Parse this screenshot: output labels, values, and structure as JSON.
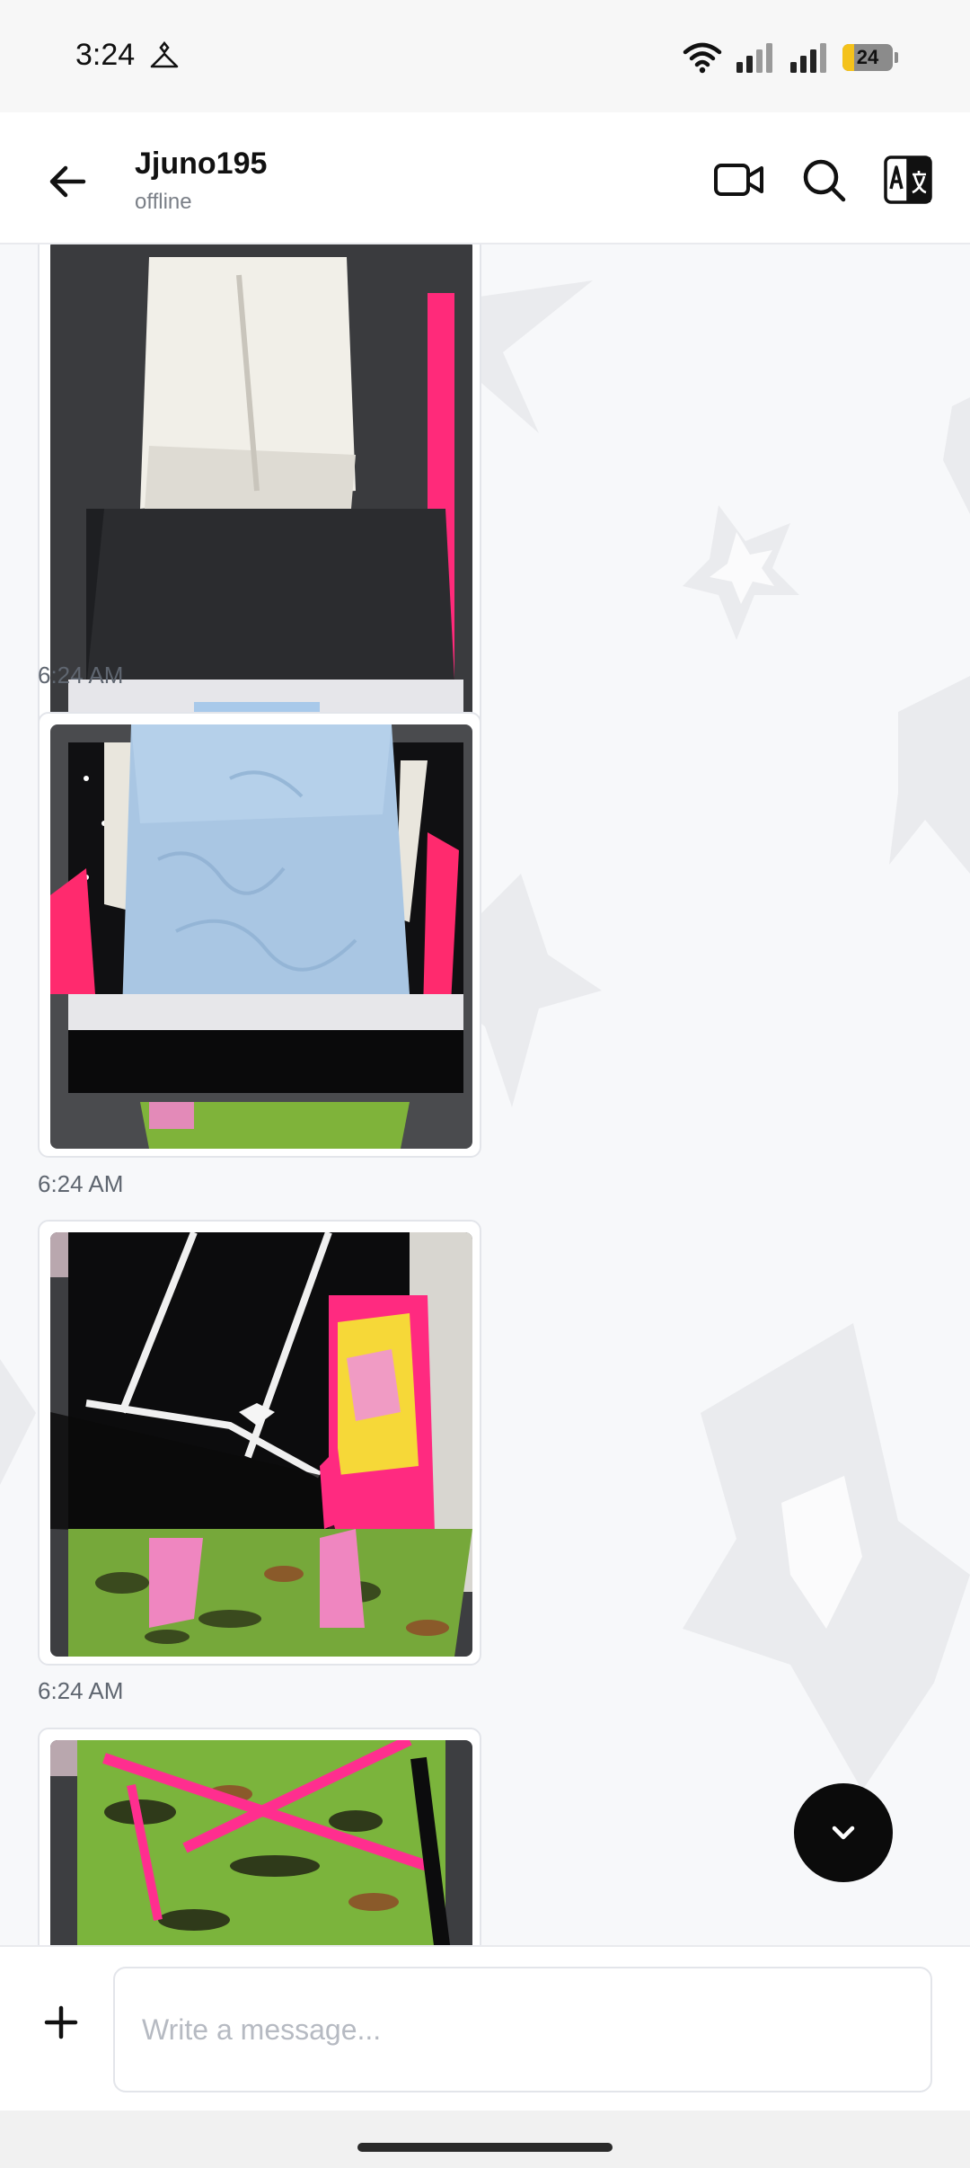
{
  "status_bar": {
    "time": "3:24",
    "battery": "24",
    "battery_level": 0.24,
    "icons": [
      "app-notification-icon",
      "wifi-icon",
      "signal-icon",
      "signal-icon",
      "battery-icon"
    ]
  },
  "header": {
    "contact_name": "Jjuno195",
    "contact_status": "offline",
    "icons": [
      "back-arrow-icon",
      "video-call-icon",
      "search-icon",
      "translate-icon"
    ]
  },
  "messages": [
    {
      "time": "6:24 AM",
      "photo": "clothing-photo-1"
    },
    {
      "time": "6:24 AM",
      "photo": "clothing-photo-2"
    },
    {
      "time": "6:24 AM",
      "photo": "clothing-photo-3"
    },
    {
      "time": "",
      "photo": "clothing-photo-4"
    }
  ],
  "composer": {
    "placeholder": "Write a message..."
  },
  "colors": {
    "accent_dark": "#0b0b0b",
    "chat_background": "#f7f8fa",
    "battery_yellow": "#f4c21b"
  }
}
